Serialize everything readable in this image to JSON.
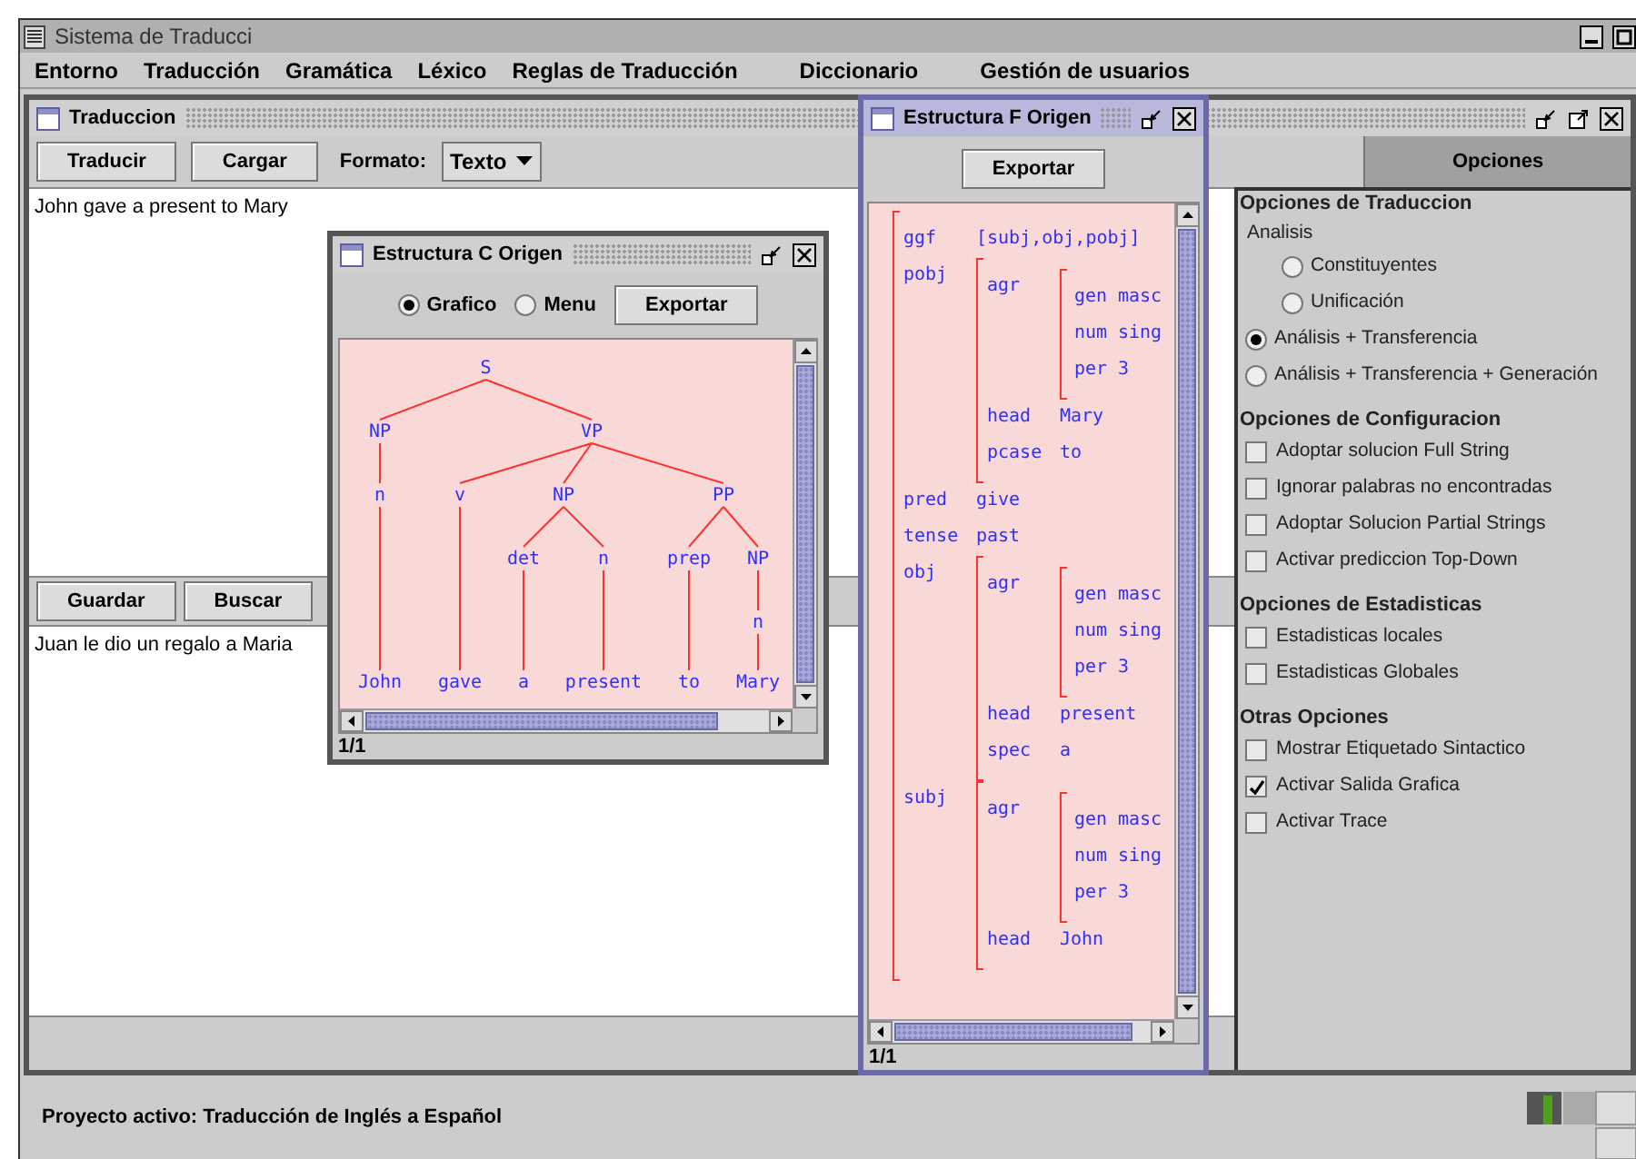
{
  "app": {
    "title": "Sistema de Traducci"
  },
  "menu": [
    "Entorno",
    "Traducción",
    "Gramática",
    "Léxico",
    "Reglas de Traducción",
    "Diccionario",
    "Gestión de usuarios"
  ],
  "translation_window": {
    "title": "Traduccion",
    "source_buttons": [
      "Traducir",
      "Cargar"
    ],
    "format_label": "Formato:",
    "format_value": "Texto",
    "source_text": "John gave a present to Mary",
    "target_buttons": [
      "Guardar",
      "Buscar"
    ],
    "target_text": "Juan le dio un regalo a Maria"
  },
  "options_panel": {
    "tab": "Opciones",
    "sections": [
      {
        "title": "Opciones de Traduccion",
        "items": [
          {
            "kind": "group",
            "label": "Analisis",
            "children": [
              {
                "kind": "radio",
                "label": "Constituyentes",
                "selected": false
              },
              {
                "kind": "radio",
                "label": "Unificación",
                "selected": false
              }
            ]
          },
          {
            "kind": "radio",
            "label": "Análisis + Transferencia",
            "selected": true
          },
          {
            "kind": "radio",
            "label": "Análisis + Transferencia + Generación",
            "selected": false
          }
        ]
      },
      {
        "title": "Opciones de Configuracion",
        "items": [
          {
            "kind": "checkbox",
            "label": "Adoptar solucion Full String",
            "checked": false
          },
          {
            "kind": "checkbox",
            "label": "Ignorar palabras no encontradas",
            "checked": false
          },
          {
            "kind": "checkbox",
            "label": "Adoptar Solucion Partial Strings",
            "checked": false
          },
          {
            "kind": "checkbox",
            "label": "Activar prediccion Top-Down",
            "checked": false
          }
        ]
      },
      {
        "title": "Opciones de Estadisticas",
        "items": [
          {
            "kind": "checkbox",
            "label": "Estadisticas locales",
            "checked": false
          },
          {
            "kind": "checkbox",
            "label": "Estadisticas Globales",
            "checked": false
          }
        ]
      },
      {
        "title": "Otras Opciones",
        "items": [
          {
            "kind": "checkbox",
            "label": "Mostrar Etiquetado Sintactico",
            "checked": false
          },
          {
            "kind": "checkbox",
            "label": "Activar Salida Grafica",
            "checked": true
          },
          {
            "kind": "checkbox",
            "label": "Activar Trace",
            "checked": false
          }
        ]
      }
    ]
  },
  "c_structure_window": {
    "title": "Estructura C Origen",
    "view_options": [
      {
        "label": "Grafico",
        "selected": true
      },
      {
        "label": "Menu",
        "selected": false
      }
    ],
    "export_button": "Exportar",
    "tree": {
      "label": "S",
      "children": [
        {
          "label": "NP",
          "children": [
            {
              "label": "n",
              "children": [
                {
                  "label": "John"
                }
              ]
            }
          ]
        },
        {
          "label": "VP",
          "children": [
            {
              "label": "v",
              "children": [
                {
                  "label": "gave"
                }
              ]
            },
            {
              "label": "NP",
              "children": [
                {
                  "label": "det",
                  "children": [
                    {
                      "label": "a"
                    }
                  ]
                },
                {
                  "label": "n",
                  "children": [
                    {
                      "label": "present"
                    }
                  ]
                }
              ]
            },
            {
              "label": "PP",
              "children": [
                {
                  "label": "prep",
                  "children": [
                    {
                      "label": "to"
                    }
                  ]
                },
                {
                  "label": "NP",
                  "children": [
                    {
                      "label": "n",
                      "children": [
                        {
                          "label": "Mary"
                        }
                      ]
                    }
                  ]
                }
              ]
            }
          ]
        }
      ]
    },
    "page": "1/1"
  },
  "f_structure_window": {
    "title": "Estructura F Origen",
    "export_button": "Exportar",
    "features": [
      {
        "attr": "ggf",
        "value": "[subj,obj,pobj]"
      },
      {
        "attr": "pobj",
        "features": [
          {
            "attr": "agr",
            "features": [
              {
                "attr": "gen",
                "value": "masc"
              },
              {
                "attr": "num",
                "value": "sing"
              },
              {
                "attr": "per",
                "value": "3"
              }
            ]
          },
          {
            "attr": "head",
            "value": "Mary"
          },
          {
            "attr": "pcase",
            "value": "to"
          }
        ]
      },
      {
        "attr": "pred",
        "value": "give"
      },
      {
        "attr": "tense",
        "value": "past"
      },
      {
        "attr": "obj",
        "features": [
          {
            "attr": "agr",
            "features": [
              {
                "attr": "gen",
                "value": "masc"
              },
              {
                "attr": "num",
                "value": "sing"
              },
              {
                "attr": "per",
                "value": "3"
              }
            ]
          },
          {
            "attr": "head",
            "value": "present"
          },
          {
            "attr": "spec",
            "value": "a"
          }
        ]
      },
      {
        "attr": "subj",
        "features": [
          {
            "attr": "agr",
            "features": [
              {
                "attr": "gen",
                "value": "masc"
              },
              {
                "attr": "num",
                "value": "sing"
              },
              {
                "attr": "per",
                "value": "3"
              }
            ]
          },
          {
            "attr": "head",
            "value": "John"
          }
        ]
      }
    ],
    "page": "1/1"
  },
  "status_bar": {
    "text": "Proyecto activo: Traducción de Inglés a Español"
  }
}
